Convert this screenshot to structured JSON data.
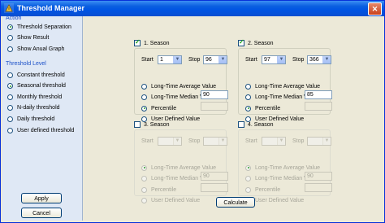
{
  "window": {
    "title": "Threshold Manager",
    "close_glyph": "✕"
  },
  "sidebar": {
    "action_header": "Action",
    "actions": [
      {
        "label": "Threshold Separation",
        "selected": true
      },
      {
        "label": "Show Result",
        "selected": false
      },
      {
        "label": "Show Anual Graph",
        "selected": false
      }
    ],
    "level_header": "Threshold Level",
    "levels": [
      {
        "label": "Constant threshold",
        "selected": false
      },
      {
        "label": "Seasonal threshold",
        "selected": true
      },
      {
        "label": "Monthly threshold",
        "selected": false
      },
      {
        "label": "N-daily threshold",
        "selected": false
      },
      {
        "label": "Daily threshold",
        "selected": false
      },
      {
        "label": "User defined threshold",
        "selected": false
      }
    ],
    "apply_label": "Apply",
    "cancel_label": "Cancel"
  },
  "seasons": [
    {
      "title": "1. Season",
      "checked": true,
      "start_label": "Start",
      "start": "1",
      "stop_label": "Stop",
      "stop": "96",
      "options": [
        "Long-Time Average Value",
        "Long-Time Median Value",
        "Percentile",
        "User Defined Value"
      ],
      "selected_option": 2,
      "percentile_value": "90",
      "user_value": ""
    },
    {
      "title": "2. Season",
      "checked": true,
      "start_label": "Start",
      "start": "97",
      "stop_label": "Stop",
      "stop": "366",
      "options": [
        "Long-Time Average Value",
        "Long-Time Median Value",
        "Percentile",
        "User Defined Value"
      ],
      "selected_option": 2,
      "percentile_value": "85",
      "user_value": ""
    },
    {
      "title": "3. Season",
      "checked": false,
      "start_label": "Start",
      "start": "",
      "stop_label": "Stop",
      "stop": "",
      "options": [
        "Long-Time Average Value",
        "Long-Time Median Value",
        "Percentile",
        "User Defined Value"
      ],
      "selected_option": 0,
      "percentile_value": "90",
      "user_value": ""
    },
    {
      "title": "4. Season",
      "checked": false,
      "start_label": "Start",
      "start": "",
      "stop_label": "Stop",
      "stop": "",
      "options": [
        "Long-Time Average Value",
        "Long-Time Median Value",
        "Percentile",
        "User Defined Value"
      ],
      "selected_option": 0,
      "percentile_value": "90",
      "user_value": ""
    }
  ],
  "calculate_label": "Calculate",
  "icons": {
    "app": "threshold-app-icon",
    "dropdown": "dropdown-arrow-icon"
  },
  "colors": {
    "title_bar": "#0054e3",
    "sidebar_bg": "#dfe8f5",
    "section_header": "#1a4fc8",
    "dialog_bg": "#ece9d8"
  }
}
